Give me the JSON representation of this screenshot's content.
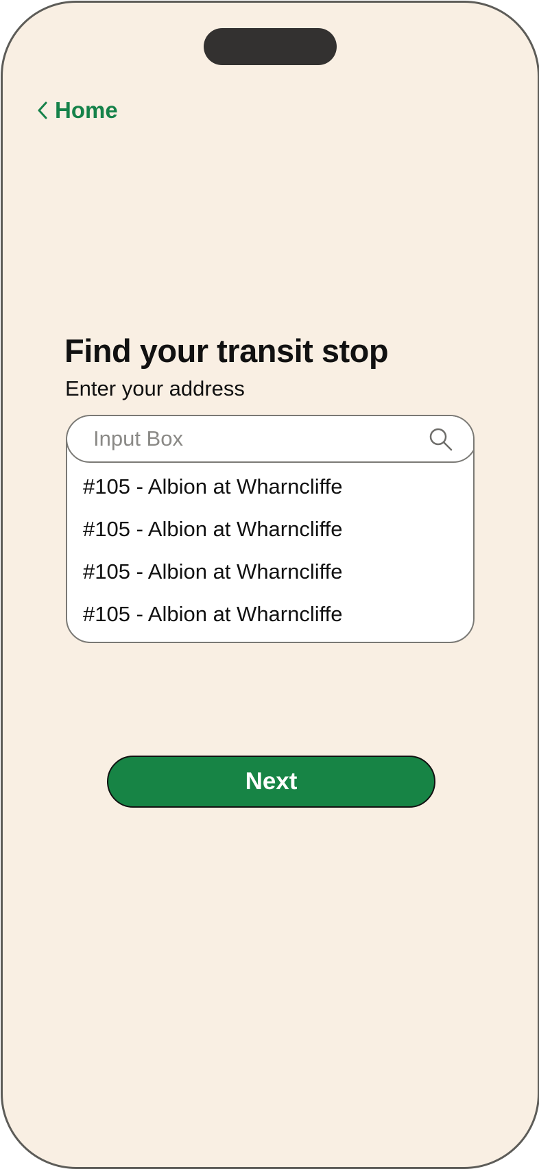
{
  "nav": {
    "back_label": "Home"
  },
  "page": {
    "title": "Find your transit stop",
    "subtitle": "Enter your address"
  },
  "search": {
    "placeholder": "Input Box",
    "value": "",
    "icon": "search-icon"
  },
  "results": [
    {
      "label": "#105 - Albion at Wharncliffe"
    },
    {
      "label": "#105 - Albion at Wharncliffe"
    },
    {
      "label": "#105 - Albion at Wharncliffe"
    },
    {
      "label": "#105 - Albion at Wharncliffe"
    }
  ],
  "actions": {
    "next_label": "Next"
  },
  "colors": {
    "background": "#f9efe3",
    "accent": "#178445",
    "link": "#16824a",
    "frame": "#5d5c58"
  }
}
